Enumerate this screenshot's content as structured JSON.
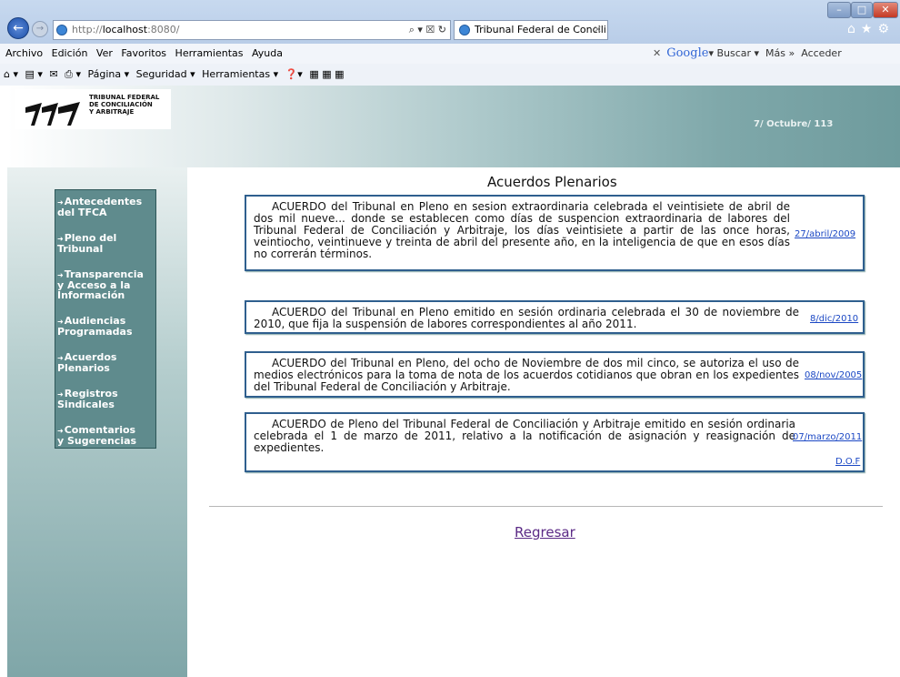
{
  "browser": {
    "address": "http://localhost:8080/",
    "address_host": "localhost",
    "address_prefix": "http://",
    "address_suffix": ":8080/",
    "address_controls": "⌕ ▾ ☒ ↻",
    "tab_title": "Tribunal Federal de Concili...",
    "menu": [
      "Archivo",
      "Edición",
      "Ver",
      "Favoritos",
      "Herramientas",
      "Ayuda"
    ],
    "search_engine": "Google",
    "search_button": "Buscar",
    "more": "Más »",
    "signin": "Acceder",
    "command_bar": [
      "Página ▾",
      "Seguridad ▾",
      "Herramientas ▾"
    ]
  },
  "banner": {
    "logo_text": [
      "TRIBUNAL FEDERAL",
      "DE CONCILIACIÓN",
      "Y ARBITRAJE"
    ],
    "date": "7/ Octubre/ 113"
  },
  "sidebar": {
    "items": [
      {
        "label_1": "Antecedentes",
        "label_2": "del TFCA"
      },
      {
        "label_1": "Pleno del",
        "label_2": "Tribunal"
      },
      {
        "label_1": "Transparencia",
        "label_2": "y Acceso a la",
        "label_3": "Información"
      },
      {
        "label_1": "Audiencias",
        "label_2": "Programadas"
      },
      {
        "label_1": "Acuerdos",
        "label_2": "Plenarios"
      },
      {
        "label_1": "Registros",
        "label_2": "Sindicales"
      },
      {
        "label_1": "Comentarios",
        "label_2": "y Sugerencias"
      }
    ]
  },
  "main": {
    "title": "Acuerdos Plenarios",
    "agreements": [
      {
        "text": "ACUERDO del Tribunal en Pleno en sesion extraordinaria celebrada el veintisiete de abril de dos mil nueve... donde se establecen como días de suspencion extraordinaria de labores del Tribunal Federal de Conciliación y Arbitraje, los días veintisiete a partir de las once horas, veintiocho, veintinueve y treinta de abril del presente año, en la inteligencia de que en esos días no correrán términos.",
        "date_link": "27/abril/2009"
      },
      {
        "text": "ACUERDO del Tribunal en Pleno emitido en sesión ordinaria celebrada el 30 de noviembre de 2010, que fija la suspensión de labores correspondientes al año 2011.",
        "date_link": "8/dic/2010"
      },
      {
        "text": "ACUERDO del Tribunal en Pleno, del ocho de Noviembre de dos mil cinco, se autoriza el uso de medios electrónicos para la toma de nota de los acuerdos cotidianos que obran en los expedientes del Tribunal Federal de Conciliación y Arbitraje.",
        "date_link": "08/nov/2005"
      },
      {
        "text": "ACUERDO de Pleno del Tribunal Federal de Conciliación y Arbitraje emitido en sesión ordinaria celebrada el 1 de marzo de 2011, relativo a la notificación de asignación y reasignación de expedientes.",
        "date_link": "07/marzo/2011",
        "extra_link": "D.O.F"
      }
    ],
    "back_link": "Regresar"
  }
}
